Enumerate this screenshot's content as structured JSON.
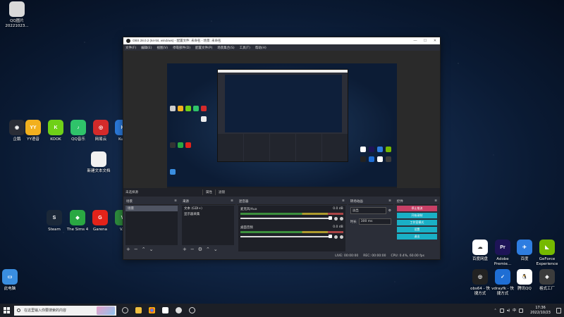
{
  "desktop": {
    "icons_left": [
      {
        "name": "qq-image-file",
        "label": "QQ图片\n20221023...",
        "color": "#d9d9d9",
        "glyph": ""
      },
      {
        "name": "app-shortcut",
        "label": "企鹅",
        "color": "#2a2d36",
        "glyph": "◉"
      },
      {
        "name": "yy-voice",
        "label": "YY语音",
        "color": "#f2b01e",
        "glyph": "YY"
      },
      {
        "name": "kook",
        "label": "KOOK",
        "color": "#6fd018",
        "glyph": "K"
      },
      {
        "name": "qq-music",
        "label": "QQ音乐",
        "color": "#2fc36a",
        "glyph": "♪"
      },
      {
        "name": "netease-music",
        "label": "网易云",
        "color": "#d42a2a",
        "glyph": "◎"
      },
      {
        "name": "ku-app",
        "label": "Ku...",
        "color": "#2a78d8",
        "glyph": "K"
      },
      {
        "name": "new-text-doc",
        "label": "新建文本文档",
        "color": "#f1f1f1",
        "glyph": ""
      },
      {
        "name": "steam",
        "label": "Steam",
        "color": "#1b2838",
        "glyph": "S"
      },
      {
        "name": "the-sims-4",
        "label": "The Sims 4",
        "color": "#2aa842",
        "glyph": "◆"
      },
      {
        "name": "garena",
        "label": "Garena",
        "color": "#e2231a",
        "glyph": "G"
      },
      {
        "name": "v-app",
        "label": "V...",
        "color": "#2d8a3c",
        "glyph": "V"
      },
      {
        "name": "this-pc",
        "label": "此电脑",
        "color": "#3a8ee0",
        "glyph": "▭"
      }
    ],
    "icons_right": [
      {
        "name": "baidu-netdisk",
        "label": "百度网盘",
        "color": "#ffffff",
        "glyph": "☁"
      },
      {
        "name": "adobe-premiere",
        "label": "Adobe\nPremie...",
        "color": "#1e1457",
        "glyph": "Pr"
      },
      {
        "name": "app-feiyu",
        "label": "百度",
        "color": "#2e7de0",
        "glyph": "✈"
      },
      {
        "name": "geforce-experience",
        "label": "GeForce\nExperience",
        "color": "#76b900",
        "glyph": "◣"
      },
      {
        "name": "obs-shortcut",
        "label": "obs64 - 快\n捷方式",
        "color": "#222",
        "glyph": "◎"
      },
      {
        "name": "vdraylik-shortcut",
        "label": "vdrayfk - 快\n捷方式",
        "color": "#1f6ed4",
        "glyph": "✓"
      },
      {
        "name": "tencent-qq",
        "label": "腾讯QQ",
        "color": "#ffffff",
        "glyph": "🐧"
      },
      {
        "name": "format-factory",
        "label": "格式工厂",
        "color": "#3c3c3c",
        "glyph": "◈"
      }
    ]
  },
  "obs": {
    "title": "OBS 28.0.2 (64-bit, windows) - 配置文件: 未命名 - 场景: 未命名",
    "menu": [
      "文件(F)",
      "编辑(E)",
      "视图(V)",
      "停靠部件(D)",
      "配置文件(P)",
      "场景集合(S)",
      "工具(T)",
      "帮助(H)"
    ],
    "scene_bar": {
      "label": "未选择源",
      "properties": "属性",
      "filters": "滤镜"
    },
    "docks": {
      "scenes": {
        "title": "场景",
        "items": [
          "场景"
        ]
      },
      "sources": {
        "title": "来源",
        "items": [
          "文本 (GDI+)",
          "显示器采集"
        ]
      },
      "mixer": {
        "title": "混音器",
        "channels": [
          {
            "name": "麦克风/Aux",
            "db": "0.0 dB"
          },
          {
            "name": "桌面音频",
            "db": "0.0 dB"
          }
        ]
      },
      "transitions": {
        "title": "转场动画",
        "type": "淡出",
        "duration_label": "时长",
        "duration": "300 ms"
      },
      "controls": {
        "title": "控件",
        "buttons": [
          "停止推流",
          "开始录制",
          "工作室模式",
          "设置",
          "退出"
        ]
      }
    },
    "status": {
      "live": "LIVE: 00:00:00",
      "rec": "REC: 00:00:00",
      "cpu": "CPU: 0.4%, 60.00 fps"
    }
  },
  "taskbar": {
    "search_placeholder": "在这里输入你要搜索的内容",
    "clock_time": "17:36",
    "clock_date": "2022/10/23"
  }
}
